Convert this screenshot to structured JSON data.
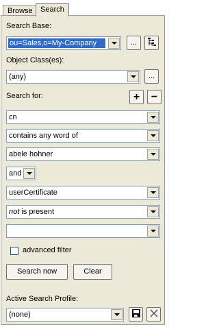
{
  "tabs": [
    "Browse",
    "Search"
  ],
  "search_base": {
    "label": "Search Base:",
    "value": "ou=Sales,o=My-Company",
    "more_label": "..."
  },
  "object_class": {
    "label": "Object Class(es):",
    "value": "(any)",
    "more_label": "..."
  },
  "search_for": {
    "label": "Search for:",
    "add_label": "+",
    "remove_label": "−"
  },
  "criteria": [
    {
      "value": "cn"
    },
    {
      "value": "contains any word of"
    },
    {
      "value": "abele hohner"
    },
    {
      "value": "and"
    },
    {
      "value": "userCertificate"
    },
    {
      "value_em": "not",
      "value_rest": " is present"
    },
    {
      "value": ""
    }
  ],
  "advanced_filter": {
    "label": "advanced filter",
    "checked": false
  },
  "buttons": {
    "search_now": "Search now",
    "clear": "Clear"
  },
  "active_profile": {
    "label": "Active Search Profile:",
    "value": "(none)"
  }
}
